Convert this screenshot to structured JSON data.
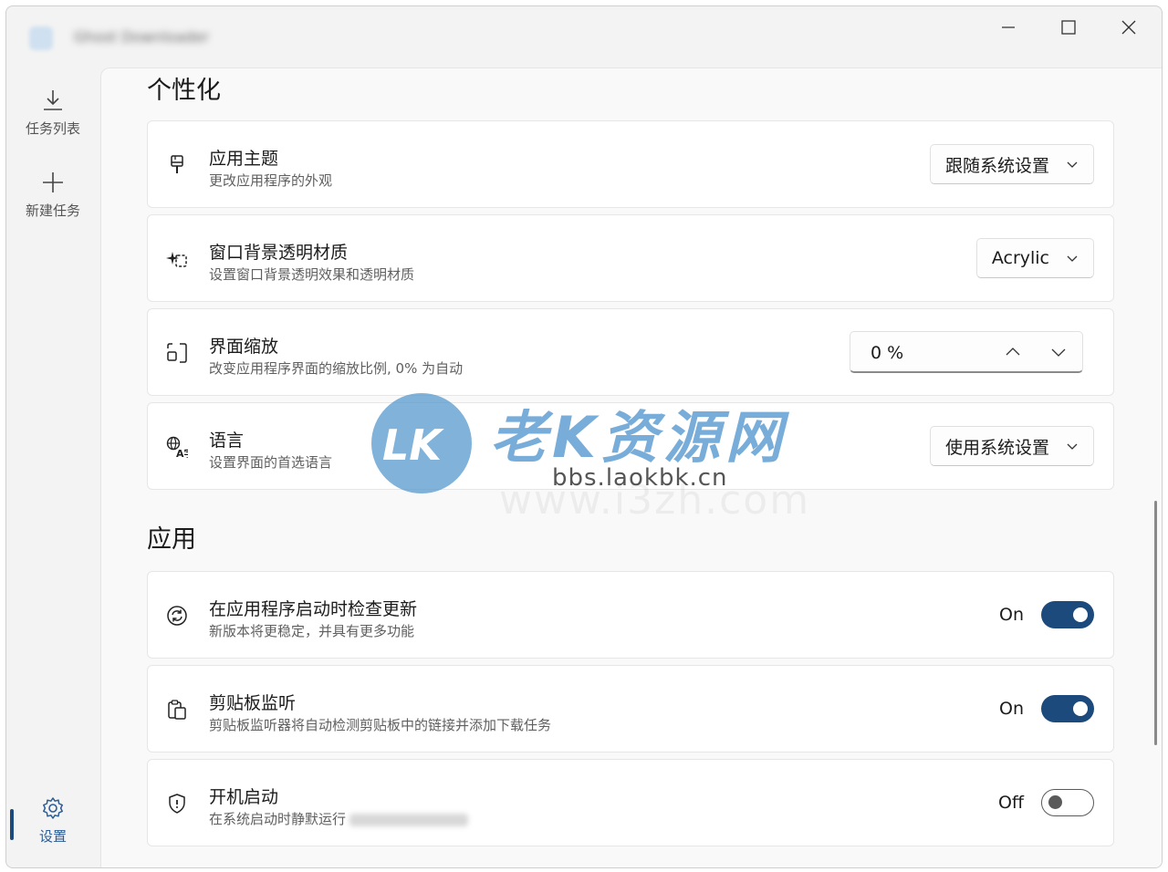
{
  "window": {
    "app_name": "Ghost Downloader",
    "controls": {
      "minimize": "minimize",
      "maximize": "maximize",
      "close": "close"
    }
  },
  "sidebar": {
    "items": [
      {
        "label": "任务列表",
        "icon": "download-icon"
      },
      {
        "label": "新建任务",
        "icon": "plus-icon"
      },
      {
        "label": "设置",
        "icon": "gear-icon"
      }
    ],
    "accent": "#1d4a7c"
  },
  "sections": [
    {
      "title": "个性化",
      "cards": [
        {
          "title": "应用主题",
          "desc": "更改应用程序的外观",
          "icon": "brush-icon",
          "control": "dropdown",
          "value": "跟随系统设置"
        },
        {
          "title": "窗口背景透明材质",
          "desc": "设置窗口背景透明效果和透明材质",
          "icon": "sparkle-select-icon",
          "control": "dropdown",
          "value": "Acrylic"
        },
        {
          "title": "界面缩放",
          "desc": "改变应用程序界面的缩放比例, 0% 为自动",
          "icon": "resize-icon",
          "control": "stepper",
          "value": "0 %"
        },
        {
          "title": "语言",
          "desc": "设置界面的首选语言",
          "icon": "translate-icon",
          "control": "dropdown",
          "value": "使用系统设置"
        }
      ]
    },
    {
      "title": "应用",
      "cards": [
        {
          "title": "在应用程序启动时检查更新",
          "desc": "新版本将更稳定，并具有更多功能",
          "icon": "sync-icon",
          "control": "toggle",
          "state": "On",
          "checked": true
        },
        {
          "title": "剪贴板监听",
          "desc": "剪贴板监听器将自动检测剪贴板中的链接并添加下载任务",
          "icon": "clipboard-icon",
          "control": "toggle",
          "state": "On",
          "checked": true
        },
        {
          "title": "开机启动",
          "desc": "在系统启动时静默运行",
          "icon": "shield-icon",
          "control": "toggle",
          "state": "Off",
          "checked": false
        }
      ]
    }
  ],
  "watermark": {
    "logo": "LK",
    "brand": "老K资源网",
    "url": "bbs.laokbk.cn",
    "faint": "www.i3zh.com"
  }
}
